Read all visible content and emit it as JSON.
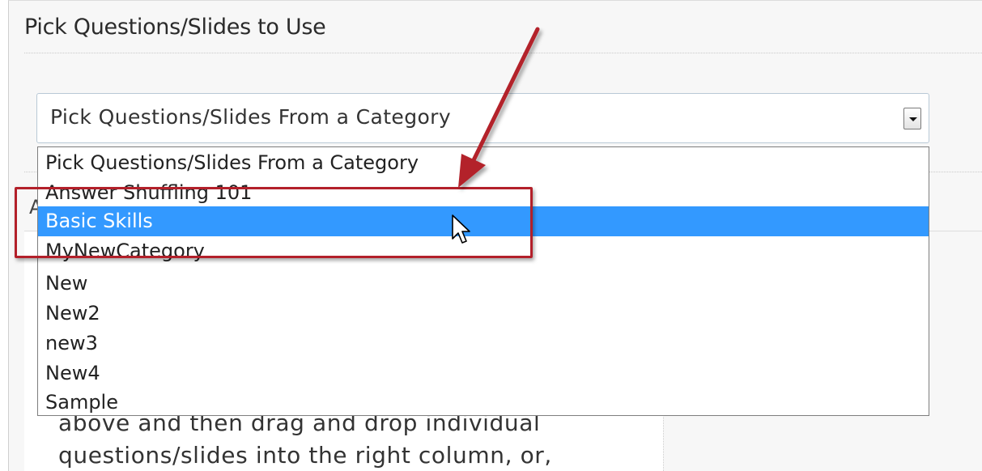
{
  "section": {
    "title": "Pick Questions/Slides to Use"
  },
  "category_select": {
    "value": "Pick Questions/Slides From a Category",
    "options": [
      "Pick Questions/Slides From a Category",
      "Answer Shuffling 101",
      "Basic Skills",
      "MyNewCategory",
      "New",
      "New2",
      "new3",
      "New4",
      "Sample"
    ],
    "highlighted_option": "Basic Skills"
  },
  "background": {
    "column_header_fragment": "A",
    "instructions": [
      "above and then drag and drop individual",
      "questions/slides into the right column, or,"
    ]
  },
  "colors": {
    "selection": "#3399ff",
    "annotation": "#b3202a"
  },
  "icons": {
    "select_arrow": "chevron-down-icon",
    "cursor": "mouse-pointer-icon",
    "annotation_arrow": "annotation-arrow-icon"
  }
}
